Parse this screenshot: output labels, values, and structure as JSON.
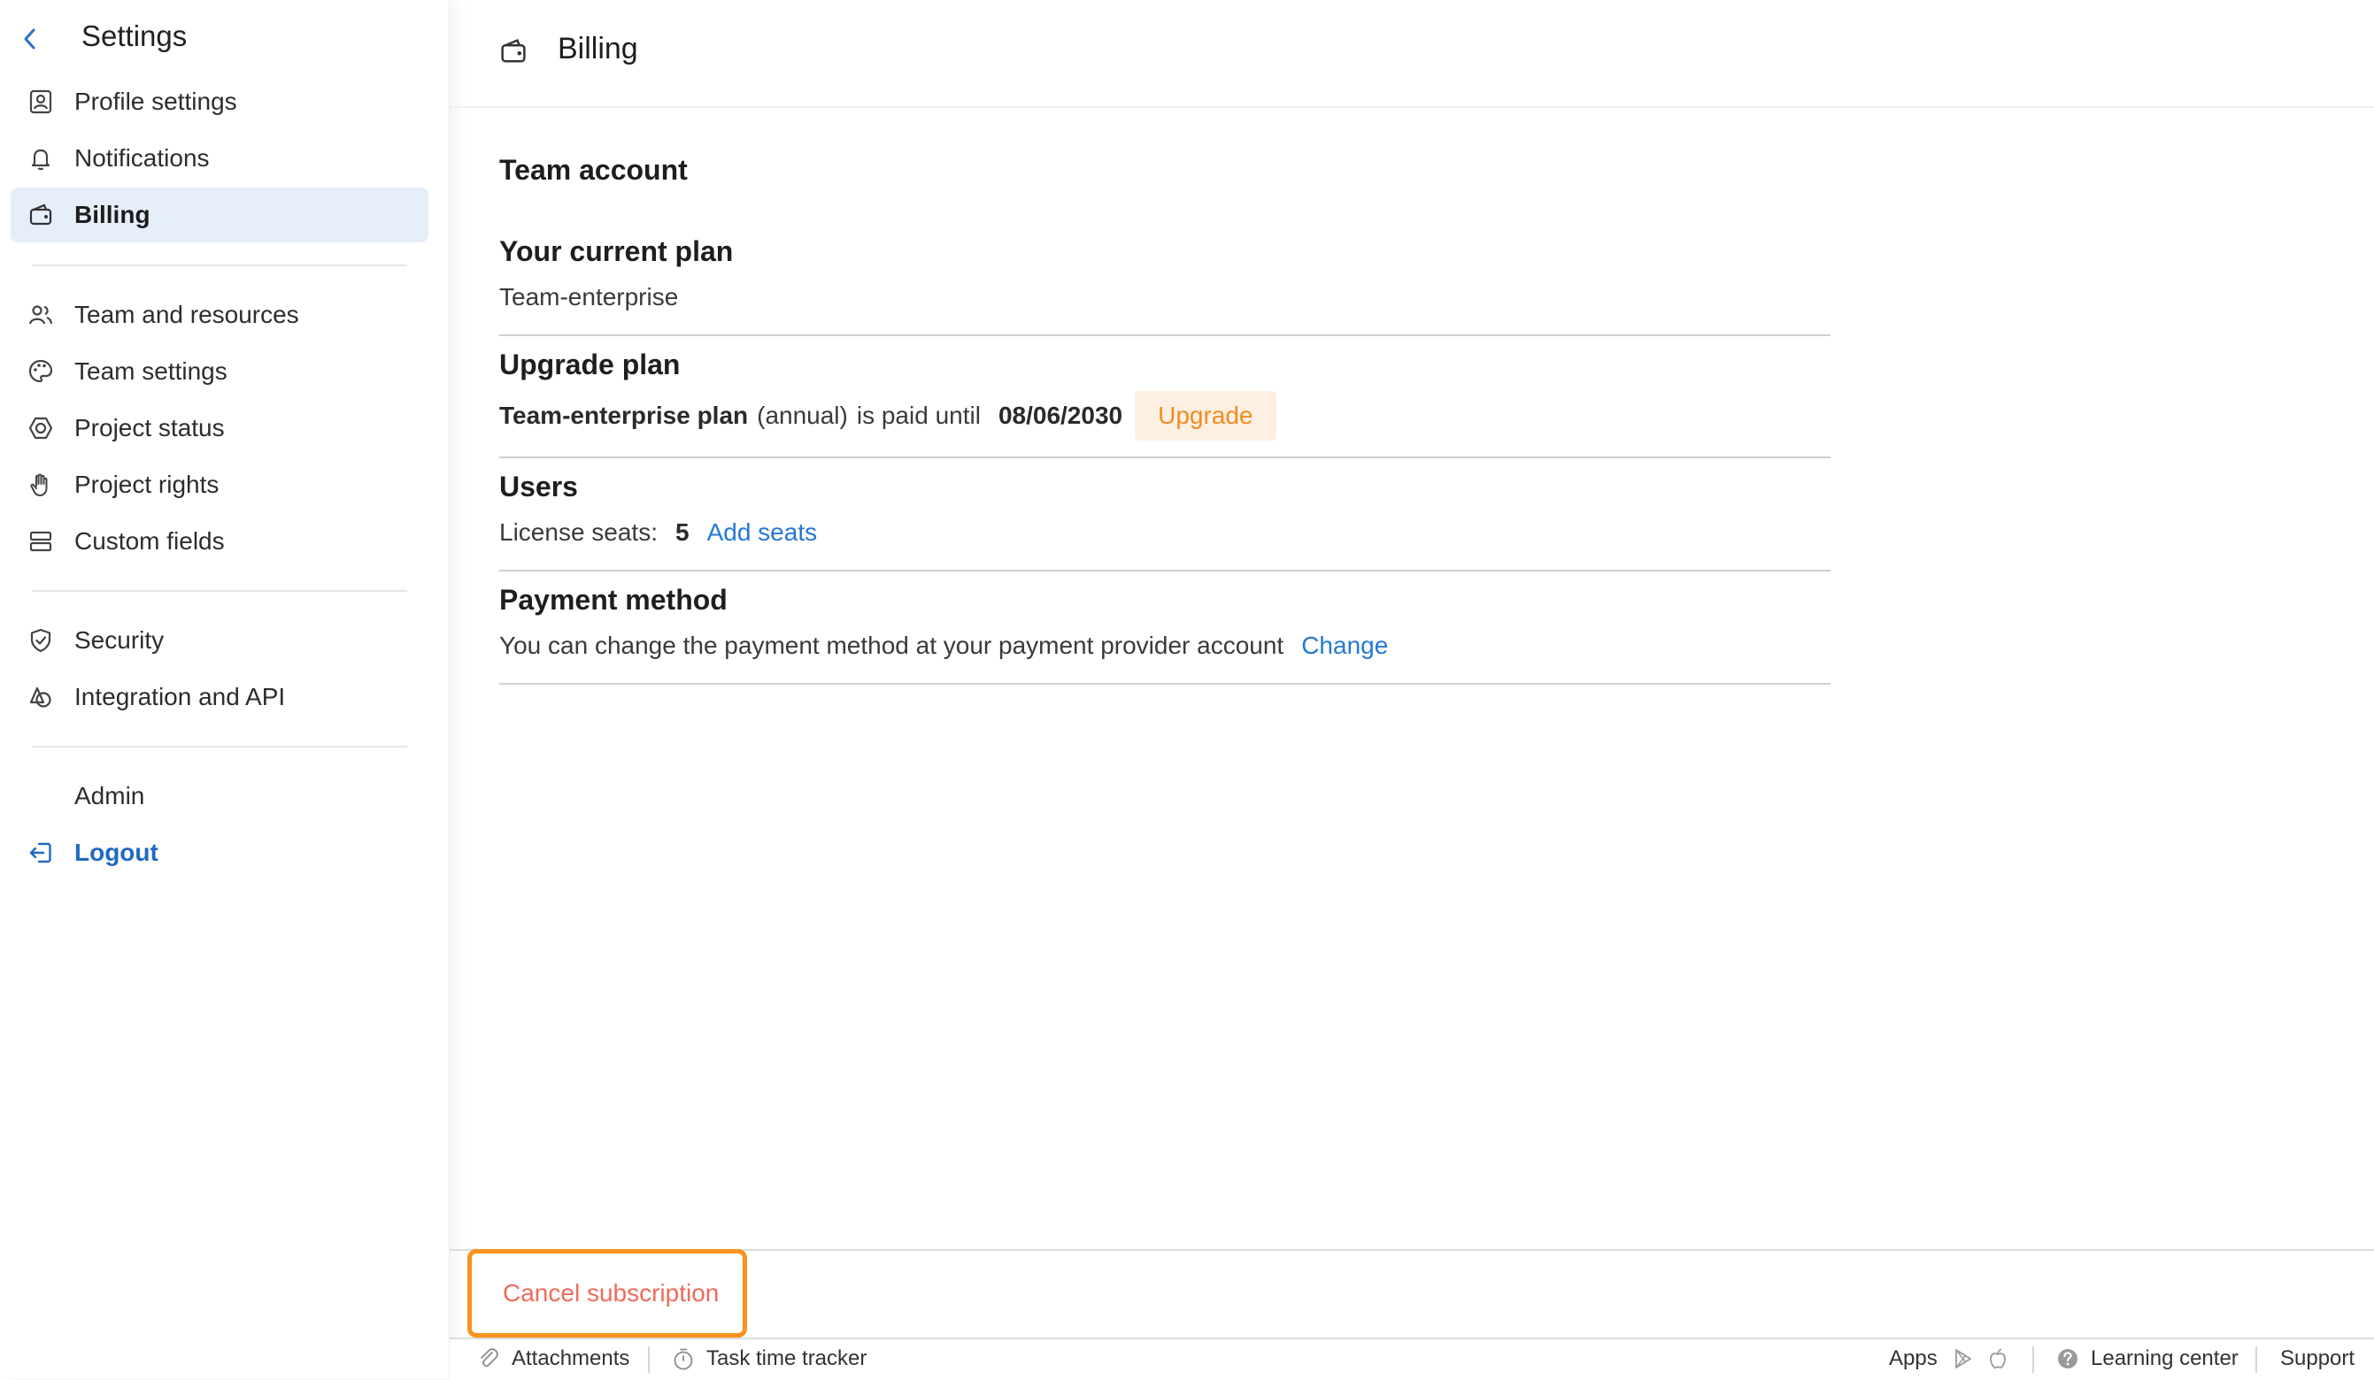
{
  "sidebar": {
    "title": "Settings",
    "groups": [
      [
        {
          "label": "Profile settings",
          "icon": "profile-icon"
        },
        {
          "label": "Notifications",
          "icon": "bell-icon"
        },
        {
          "label": "Billing",
          "icon": "wallet-icon",
          "active": true
        }
      ],
      [
        {
          "label": "Team and resources",
          "icon": "people-icon"
        },
        {
          "label": "Team settings",
          "icon": "palette-icon"
        },
        {
          "label": "Project status",
          "icon": "status-icon"
        },
        {
          "label": "Project rights",
          "icon": "hand-icon"
        },
        {
          "label": "Custom fields",
          "icon": "fields-icon"
        }
      ],
      [
        {
          "label": "Security",
          "icon": "shield-icon"
        },
        {
          "label": "Integration and API",
          "icon": "integration-icon"
        }
      ]
    ],
    "admin_label": "Admin",
    "logout_label": "Logout"
  },
  "header": {
    "title": "Billing"
  },
  "billing": {
    "team_account": "Team account",
    "current_plan": {
      "heading": "Your current plan",
      "value": "Team-enterprise"
    },
    "upgrade_plan": {
      "heading": "Upgrade plan",
      "plan_name": "Team-enterprise plan",
      "period": "(annual)",
      "paid_until_text": "is paid until",
      "date": "08/06/2030",
      "button": "Upgrade"
    },
    "users": {
      "heading": "Users",
      "seats_label": "License seats:",
      "seats_value": "5",
      "add_seats": "Add seats"
    },
    "payment": {
      "heading": "Payment method",
      "text": "You can change the payment method at your payment provider account",
      "change_link": "Change"
    },
    "cancel_label": "Cancel subscription"
  },
  "footer": {
    "attachments": "Attachments",
    "time_tracker": "Task time tracker",
    "apps": "Apps",
    "learning_center": "Learning center",
    "support": "Support"
  },
  "colors": {
    "accent": "#1f69c2",
    "link": "#2478d6",
    "upgrade_text": "#f08c22",
    "upgrade_bg": "#fdf0e2",
    "cancel_text": "#ef6b5a",
    "highlight_border": "#f7931e",
    "active_bg": "#e6eef9"
  }
}
